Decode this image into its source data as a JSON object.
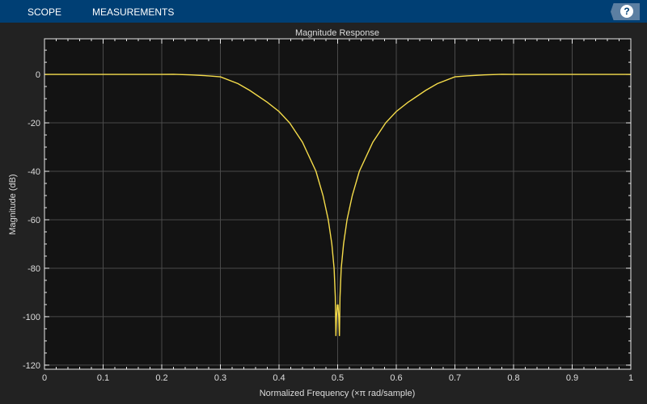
{
  "toolbar": {
    "tabs": [
      "SCOPE",
      "MEASUREMENTS"
    ],
    "help_icon": "question-mark-icon",
    "help_label": "?"
  },
  "colors": {
    "toolbar": "#003f74",
    "background": "#222222",
    "axes": "#131313",
    "grid": "#4a4a4a",
    "line": "#f5dc4a"
  },
  "chart_data": {
    "type": "line",
    "title": "Magnitude Response",
    "xlabel": "Normalized Frequency (×π rad/sample)",
    "ylabel": "Magnitude (dB)",
    "xlim": [
      0,
      1
    ],
    "ylim": [
      -121.7,
      14.7
    ],
    "xticks": [
      0,
      0.1,
      0.2,
      0.3,
      0.4,
      0.5,
      0.6,
      0.7,
      0.8,
      0.9,
      1
    ],
    "xtick_labels": [
      "0",
      "0.1",
      "0.2",
      "0.3",
      "0.4",
      "0.5",
      "0.6",
      "0.7",
      "0.8",
      "0.9",
      "1"
    ],
    "yticks": [
      0,
      -20,
      -40,
      -60,
      -80,
      -100,
      -120
    ],
    "ytick_labels": [
      "0",
      "-20",
      "-40",
      "-60",
      "-80",
      "-100",
      "-120"
    ],
    "grid": true,
    "series": [
      {
        "name": "Magnitude",
        "x": [
          0,
          0.2,
          0.22,
          0.25,
          0.28,
          0.3,
          0.33,
          0.35,
          0.38,
          0.4,
          0.418,
          0.44,
          0.463,
          0.475,
          0.484,
          0.49,
          0.494,
          0.496,
          0.497,
          0.498,
          0.4995,
          0.5,
          0.5005,
          0.502,
          0.503,
          0.504,
          0.506,
          0.51,
          0.516,
          0.525,
          0.537,
          0.56,
          0.582,
          0.6,
          0.62,
          0.65,
          0.67,
          0.7,
          0.72,
          0.75,
          0.78,
          0.8,
          1
        ],
        "y": [
          0,
          0,
          0.05,
          -0.2,
          -0.6,
          -1,
          -3.8,
          -6.6,
          -11.5,
          -15.3,
          -20,
          -28,
          -40,
          -50,
          -60,
          -70,
          -80,
          -92,
          -108,
          -100,
          -95,
          -96,
          -95,
          -100,
          -108,
          -92,
          -80,
          -70,
          -60,
          -50,
          -40,
          -28,
          -20,
          -15.3,
          -11.5,
          -6.6,
          -3.8,
          -1,
          -0.6,
          -0.2,
          0.05,
          0,
          0
        ]
      }
    ]
  }
}
